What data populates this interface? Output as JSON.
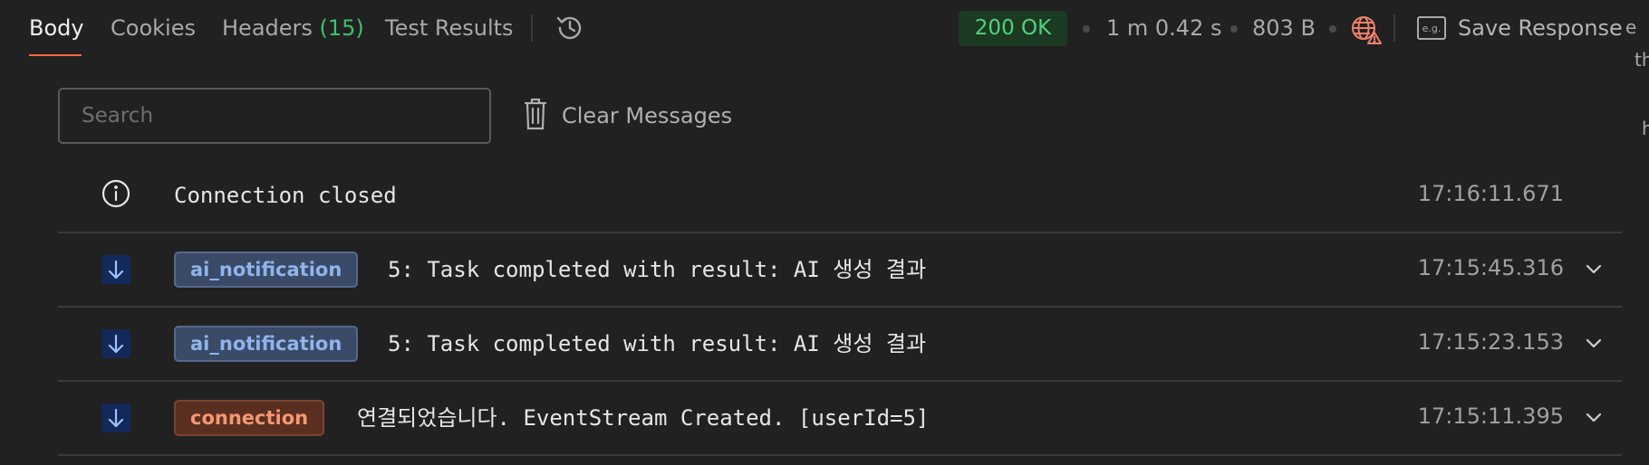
{
  "tabs": [
    {
      "label": "Body",
      "active": true
    },
    {
      "label": "Cookies",
      "active": false
    },
    {
      "label": "Headers",
      "count": "(15)",
      "active": false
    },
    {
      "label": "Test Results",
      "active": false
    }
  ],
  "response": {
    "status": "200 OK",
    "time": "1 m 0.42 s",
    "size": "803 B",
    "save_label": "Save Response",
    "example_icon_text": "e.g."
  },
  "cutoff_text": {
    "a": "e",
    "b": "th",
    "c": "h"
  },
  "search": {
    "placeholder": "Search",
    "value": ""
  },
  "clear_label": "Clear Messages",
  "messages": [
    {
      "type": "info",
      "event": "",
      "text": "Connection closed",
      "time": "17:16:11.671",
      "expandable": false
    },
    {
      "type": "incoming",
      "event": "ai_notification",
      "text": "5: Task completed with result: AI 생성 결과",
      "time": "17:15:45.316",
      "expandable": true
    },
    {
      "type": "incoming",
      "event": "ai_notification",
      "text": "5: Task completed with result: AI 생성 결과",
      "time": "17:15:23.153",
      "expandable": true
    },
    {
      "type": "incoming",
      "event": "connection",
      "text": "연결되었습니다. EventStream Created. [userId=5]",
      "time": "17:15:11.395",
      "expandable": true
    }
  ],
  "colors": {
    "background": "#212121",
    "accent": "#f26b3a",
    "status_green": "#4fd27e",
    "count_green": "#3fbf6f",
    "notif_badge": "#8fb4ec",
    "conn_badge": "#f3996f",
    "arrow_box": "#13295a"
  },
  "icons": {
    "history": "history-icon",
    "globe_warning": "globe-warning-icon",
    "trash": "trash-icon",
    "info": "info-icon",
    "arrow_down": "arrow-down-icon",
    "chevron": "chevron-down-icon"
  }
}
